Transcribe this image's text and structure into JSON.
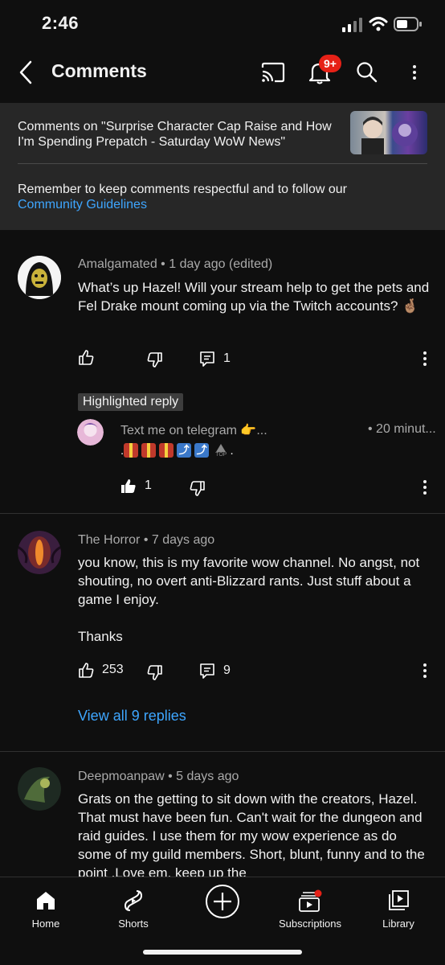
{
  "status_bar": {
    "time": "2:46"
  },
  "header": {
    "title": "Comments",
    "notification_count": "9+"
  },
  "video_context": {
    "title": "Comments on \"Surprise Character Cap Raise and How I'm Spending Prepatch - Saturday WoW News\"",
    "guideline_text": "Remember to keep comments respectful and to follow our",
    "guideline_link": "Community Guidelines"
  },
  "comments": [
    {
      "author": "Amalgamated",
      "time": "1 day ago (edited)",
      "text": "What’s up Hazel! Will your stream help to get the pets and Fel Drake mount coming up via the Twitch accounts? 🤞🏽",
      "likes": "",
      "replies": "1",
      "highlighted_label": "Highlighted reply",
      "highlighted": {
        "author": "Text me on telegram 👉...",
        "time": "20 minut...",
        "likes": "1",
        "top_label": "TOP"
      }
    },
    {
      "author": "The Horror",
      "time": "7 days ago",
      "text": "you know, this is my favorite wow channel. No angst, not shouting, no overt anti-Blizzard rants. Just stuff about a game I enjoy.",
      "text2": "Thanks",
      "likes": "253",
      "replies": "9",
      "view_replies": "View all 9 replies"
    },
    {
      "author": "Deepmoanpaw",
      "time": "5 days ago",
      "text": "Grats on the getting to sit down with the creators, Hazel. That must have been fun. Can't wait for the dungeon and raid guides. I use them for my wow experience as do some of my guild members. Short, blunt, funny and to the point .Love em, keep up the"
    }
  ],
  "bottom_nav": {
    "items": [
      {
        "label": "Home",
        "icon": "home-icon"
      },
      {
        "label": "Shorts",
        "icon": "shorts-icon"
      },
      {
        "label": "",
        "icon": "create-icon"
      },
      {
        "label": "Subscriptions",
        "icon": "subscriptions-icon"
      },
      {
        "label": "Library",
        "icon": "library-icon"
      }
    ]
  },
  "colors": {
    "background": "#0f0f0f",
    "panel": "#272727",
    "link": "#3ea6ff",
    "badge": "#e62117"
  }
}
